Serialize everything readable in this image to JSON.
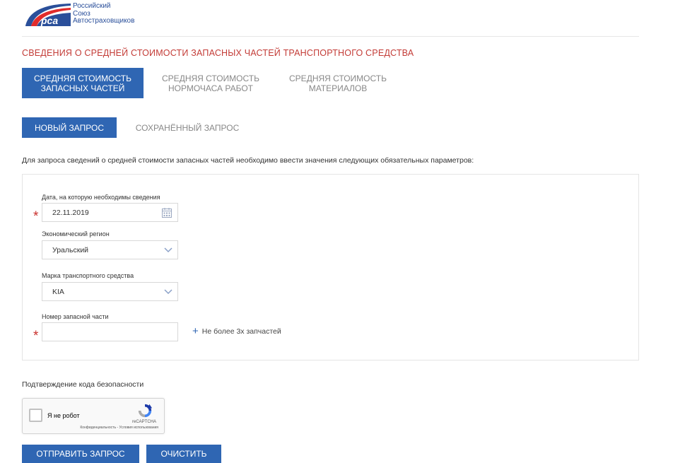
{
  "header": {
    "logo_abbr": "рса",
    "logo_lines": [
      "Российский",
      "Союз",
      "Автостраховщиков"
    ]
  },
  "page_title": "СВЕДЕНИЯ О СРЕДНЕЙ СТОИМОСТИ ЗАПАСНЫХ ЧАСТЕЙ ТРАНСПОРТНОГО СРЕДСТВА",
  "main_tabs": [
    {
      "line1": "СРЕДНЯЯ СТОИМОСТЬ",
      "line2": "ЗАПАСНЫХ ЧАСТЕЙ",
      "active": true
    },
    {
      "line1": "СРЕДНЯЯ СТОИМОСТЬ",
      "line2": "НОРМОЧАСА РАБОТ",
      "active": false
    },
    {
      "line1": "СРЕДНЯЯ СТОИМОСТЬ",
      "line2": "МАТЕРИАЛОВ",
      "active": false
    }
  ],
  "sub_tabs": [
    {
      "label": "НОВЫЙ ЗАПРОС",
      "active": true
    },
    {
      "label": "СОХРАНЁННЫЙ ЗАПРОС",
      "active": false
    }
  ],
  "intro_text": "Для запроса сведений о средней стоимости запасных частей необходимо ввести значения следующих обязательных параметров:",
  "form": {
    "required_mark": "*",
    "date": {
      "label": "Дата, на которую необходимы сведения",
      "value": "22.11.2019",
      "icon": "calendar-icon"
    },
    "region": {
      "label": "Экономический регион",
      "value": "Уральский",
      "icon": "chevron-down-icon"
    },
    "brand": {
      "label": "Марка транспортного средства",
      "value": "KIA",
      "icon": "chevron-down-icon"
    },
    "part_number": {
      "label": "Номер запасной части",
      "value": ""
    },
    "add_part": {
      "icon": "+",
      "label": "Не более 3х запчастей"
    }
  },
  "captcha": {
    "title": "Подтверждение кода безопасности",
    "checkbox_label": "Я не робот",
    "brand": "reCAPTCHA",
    "links": "Конфиденциальность - Условия использования"
  },
  "buttons": {
    "submit": "ОТПРАВИТЬ ЗАПРОС",
    "clear": "ОЧИСТИТЬ"
  },
  "colors": {
    "accent": "#2f66b3",
    "title_red": "#c33b36",
    "required_red": "#c9302c"
  }
}
